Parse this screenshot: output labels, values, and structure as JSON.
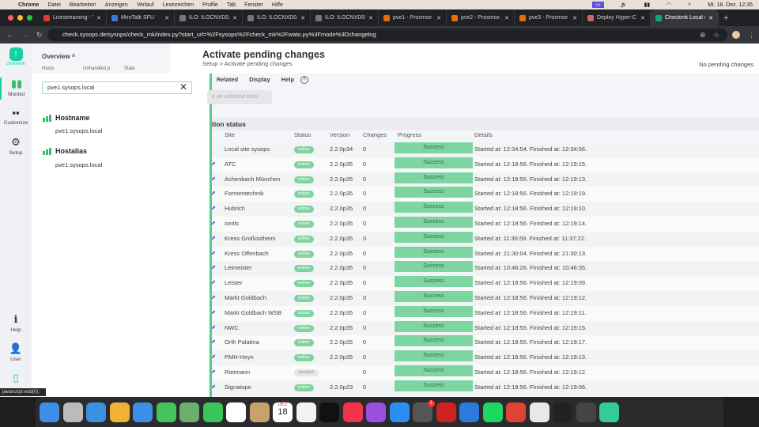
{
  "menubar": {
    "items": [
      "Chrome",
      "Datei",
      "Bearbeiten",
      "Anzeigen",
      "Verlauf",
      "Lesezeichen",
      "Profile",
      "Tab",
      "Fenster",
      "Hilfe"
    ],
    "datetime": "Mi. 18. Dez. 12:35"
  },
  "tabs": [
    {
      "label": "Livestreaming - Y",
      "color": "#e03b2f"
    },
    {
      "label": "MiroTalk SFU",
      "color": "#3a7bd5"
    },
    {
      "label": "ILO: ILOCNXD0J",
      "color": "#777"
    },
    {
      "label": "ILO: ILOCNXD0J",
      "color": "#777"
    },
    {
      "label": "ILO: ILOCNXD0I",
      "color": "#777"
    },
    {
      "label": "pve1 - Proxmox V",
      "color": "#e57000"
    },
    {
      "label": "pve2 - Proxmox V",
      "color": "#e57000"
    },
    {
      "label": "pve3 - Proxmox V",
      "color": "#e57000"
    },
    {
      "label": "Deploy Hyper-C",
      "color": "#c66"
    },
    {
      "label": "Checkmk Local s",
      "color": "#15a67a"
    }
  ],
  "url": "check.sysops.de/sysops/check_mk/index.py?start_url=%2Fsysops%2Fcheck_mk%2Fwato.py%3Fmode%3Dchangelog",
  "nav": {
    "logo": "checkmk",
    "items": [
      "Monitor",
      "Customize",
      "Setup",
      "Help",
      "User"
    ]
  },
  "overview": {
    "title": "Overview",
    "cols": [
      "Hosts",
      "Unhandled p.",
      "Stale"
    ]
  },
  "search": {
    "value": "pve1.sysops.local"
  },
  "results": [
    {
      "group": "Hostname",
      "hit": "pve1.sysops.local"
    },
    {
      "group": "Hostalias",
      "hit": "pve1.sysops.local"
    }
  ],
  "main": {
    "title": "Activate pending changes",
    "breadcrumb": "Setup > Activate pending changes",
    "no_pending": "No pending changes",
    "menu": [
      "Related",
      "Display",
      "Help"
    ],
    "activate_button": "e on selected sites",
    "section": "tion status",
    "columns": [
      "Site",
      "Status",
      "Version",
      "Changes",
      "Progress",
      "Details"
    ]
  },
  "rows": [
    [
      "Local site sysops",
      "online",
      "2.2.0p34",
      "0",
      "Success",
      "Started at: 12:34:54. Finished at: 12:34:56."
    ],
    [
      "ATC",
      "online",
      "2.2.0p35",
      "0",
      "Success",
      "Started at: 12:18:56. Finished at: 12:19:15."
    ],
    [
      "Achenbach München",
      "online",
      "2.2.0p35",
      "0",
      "Success",
      "Started at: 12:18:55. Finished at: 12:19:13."
    ],
    [
      "Formentechnik",
      "online",
      "2.2.0p35",
      "0",
      "Success",
      "Started at: 12:18:56. Finished at: 12:19:19."
    ],
    [
      "Hubrich",
      "online",
      "2.2.0p35",
      "0",
      "Success",
      "Started at: 12:18:56. Finished at: 12:19:10."
    ],
    [
      "Iontis",
      "online",
      "2.2.0p35",
      "0",
      "Success",
      "Started at: 12:18:56. Finished at: 12:19:14."
    ],
    [
      "Kress Großostheim",
      "online",
      "2.2.0p35",
      "0",
      "Success",
      "Started at: 11:36:59. Finished at: 11:37:22."
    ],
    [
      "Kress Offenbach",
      "online",
      "2.2.0p35",
      "0",
      "Success",
      "Started at: 21:30:04. Finished at: 21:30:13."
    ],
    [
      "Leimeister",
      "online",
      "2.2.0p35",
      "0",
      "Success",
      "Started at: 10:46:26. Finished at: 10:46:35."
    ],
    [
      "Leister",
      "online",
      "2.2.0p35",
      "0",
      "Success",
      "Started at: 12:18:56. Finished at: 12:19:09."
    ],
    [
      "Markt Goldbach",
      "online",
      "2.2.0p35",
      "0",
      "Success",
      "Started at: 12:18:56. Finished at: 12:19:12."
    ],
    [
      "Markt Goldbach WSB",
      "online",
      "2.2.0p35",
      "0",
      "Success",
      "Started at: 12:18:56. Finished at: 12:19:11."
    ],
    [
      "NWC",
      "online",
      "2.2.0p35",
      "0",
      "Success",
      "Started at: 12:18:55. Finished at: 12:19:15."
    ],
    [
      "Orth Palatina",
      "online",
      "2.2.0p35",
      "0",
      "Success",
      "Started at: 12:18:55. Finished at: 12:19:17."
    ],
    [
      "PMH-Heyn",
      "online",
      "2.2.0p35",
      "0",
      "Success",
      "Started at: 12:18:56. Finished at: 12:19:13."
    ],
    [
      "Rietmann",
      "disabled",
      "",
      "0",
      "Success",
      "Started at: 12:18:56. Finished at: 12:19:12."
    ],
    [
      "Signatope",
      "online",
      "2.2.0p23",
      "0",
      "Success",
      "Started at: 12:18:56. Finished at: 12:19:06."
    ]
  ],
  "statusbar": "javascript:void(0);",
  "dock": {
    "calendar_month": "DEZ",
    "calendar_day": "18",
    "badge": "1",
    "colors": [
      "#3b8fe8",
      "#bbb",
      "#3a8fe0",
      "#f2b134",
      "#3d8ee6",
      "#46c35a",
      "#6ab06a",
      "#3bc45a",
      "#fff",
      "#c9a26b",
      "#fff",
      "#f2f2f2",
      "#111",
      "#f3324b",
      "#9b4fe0",
      "#2b8ef0",
      "#555",
      "#c22",
      "#2a7ae0",
      "#1ed760",
      "#d43",
      "#e8e8e8",
      "#222",
      "#444",
      "#3c9"
    ]
  }
}
